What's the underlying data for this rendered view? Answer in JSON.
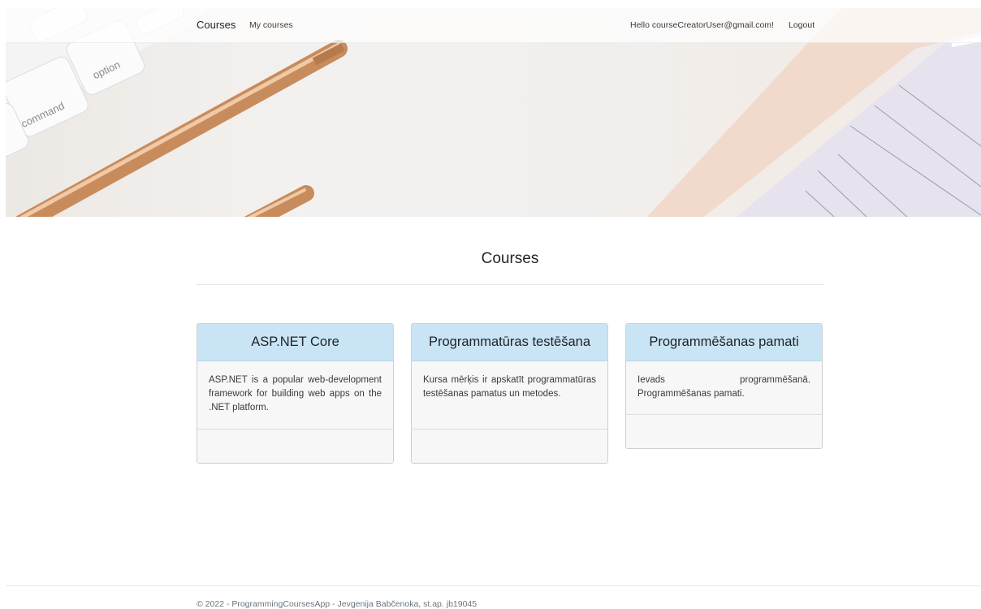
{
  "navbar": {
    "brand": "Courses",
    "my_courses": "My courses",
    "greeting": "Hello courseCreatorUser@gmail.com!",
    "logout": "Logout"
  },
  "hero": {
    "keyboard_keys": [
      "option",
      "command"
    ]
  },
  "main": {
    "title": "Courses",
    "cards": [
      {
        "title": "ASP.NET Core",
        "description": "ASP.NET is a popular web-development framework for building web apps on the .NET platform."
      },
      {
        "title": "Programmatūras testēšana",
        "description": "Kursa mērķis ir apskatīt programmatūras testēšanas pamatus un metodes."
      },
      {
        "title": "Programmēšanas pamati",
        "description": "Ievads programmēšanā. Programmēšanas pamati."
      }
    ]
  },
  "footer": {
    "text": "© 2022 - ProgrammingCoursesApp - Jevgenija Babčenoka, st.ap. jb19045"
  },
  "colors": {
    "card_header": "#c9e4f5",
    "card_bg": "#f7f7f8"
  }
}
